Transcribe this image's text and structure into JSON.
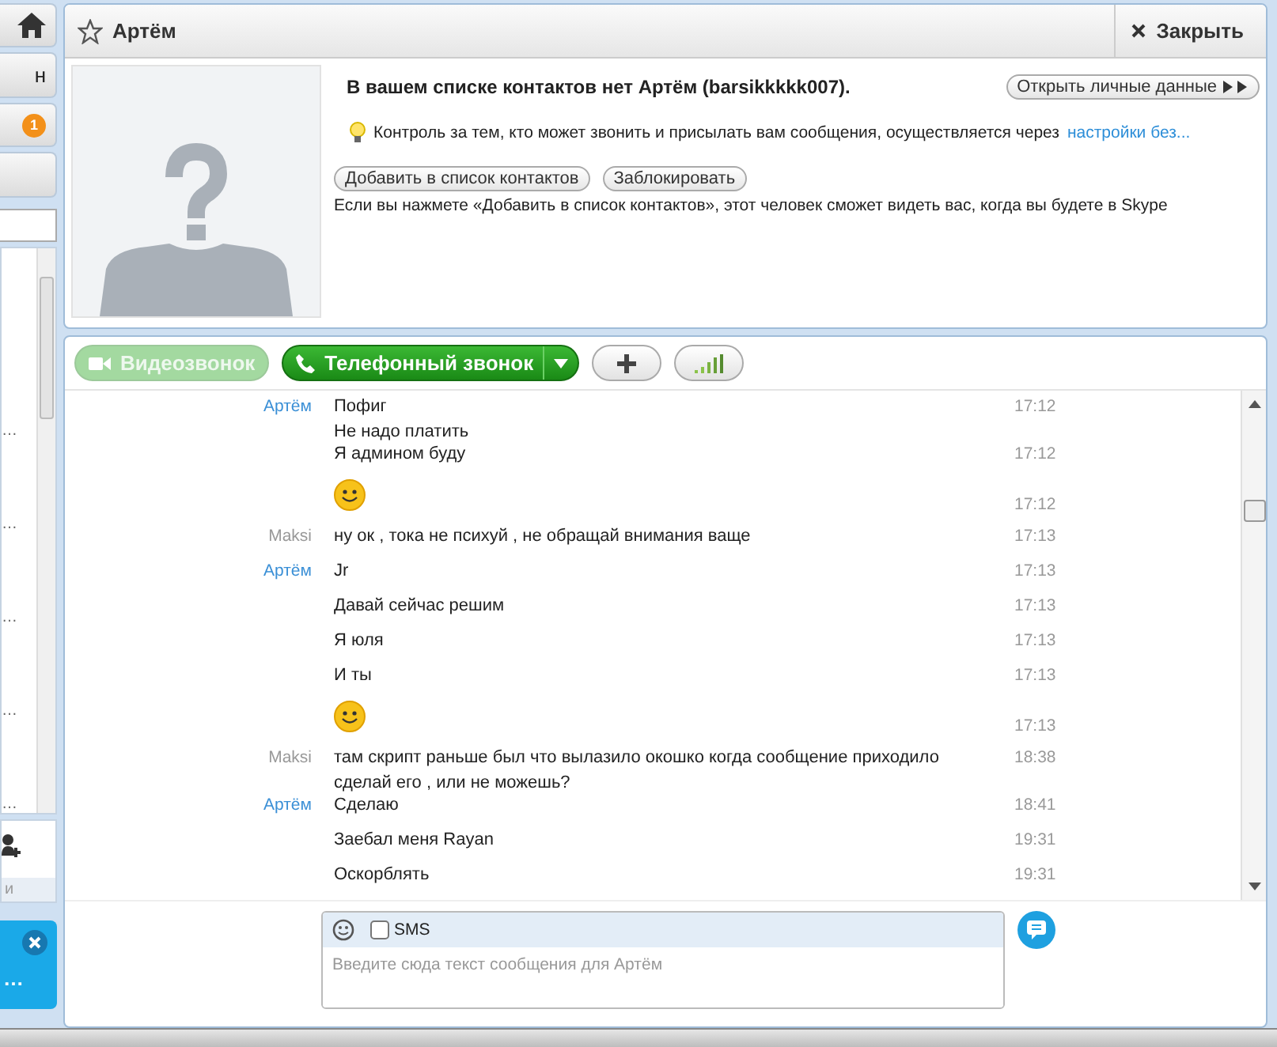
{
  "sidebar": {
    "partial_label": "н",
    "badge": "1",
    "list_items": [
      "…",
      "…",
      "…",
      "…",
      "…"
    ],
    "footer_label": "и",
    "notification_text": "…"
  },
  "header": {
    "contact_name": "Артём",
    "close_button": "Закрыть"
  },
  "profile": {
    "title": "В вашем списке контактов нет Артём (barsikkkkk007).",
    "open_profile_button": "Открыть личные данные",
    "privacy_text": "Контроль за тем, кто может звонить и присылать вам сообщения, осуществляется через",
    "privacy_link": "настройки без...",
    "buttons": [
      "Добавить в список контактов",
      "Заблокировать"
    ],
    "note": "Если вы нажмете «Добавить в список контактов», этот человек сможет видеть вас, когда вы будете в Skype"
  },
  "call_toolbar": {
    "video_call": {
      "label": "Видеозвонок",
      "disabled": true
    },
    "phone_call": {
      "label": "Телефонный звонок",
      "disabled": false
    }
  },
  "messages": [
    {
      "sender": "Артём",
      "self": false,
      "kind": "text",
      "lines": [
        "Пофиг",
        "Не надо платить"
      ],
      "time": "17:12"
    },
    {
      "kind": "text",
      "lines": [
        "Я админом буду"
      ],
      "time": "17:12"
    },
    {
      "kind": "emoticon",
      "time": "17:12"
    },
    {
      "sender": "Maksi",
      "self": true,
      "kind": "text",
      "lines": [
        "ну ок , тока не психуй , не обращай внимания ваще"
      ],
      "time": "17:13"
    },
    {
      "sender": "Артём",
      "self": false,
      "kind": "text",
      "lines": [
        "Jr"
      ],
      "time": "17:13"
    },
    {
      "kind": "text",
      "lines": [
        "Давай сейчас решим"
      ],
      "time": "17:13"
    },
    {
      "kind": "text",
      "lines": [
        "Я юля"
      ],
      "time": "17:13"
    },
    {
      "kind": "text",
      "lines": [
        "И ты"
      ],
      "time": "17:13"
    },
    {
      "kind": "emoticon",
      "time": "17:13"
    },
    {
      "sender": "Maksi",
      "self": true,
      "kind": "text",
      "lines": [
        "там скрипт раньше был что вылазило окошко когда сообщение приходило",
        "сделай его , или не можешь?"
      ],
      "time": "18:38"
    },
    {
      "sender": "Артём",
      "self": false,
      "kind": "text",
      "lines": [
        "Сделаю"
      ],
      "time": "18:41"
    },
    {
      "kind": "text",
      "lines": [
        "Заебал меня Rayan"
      ],
      "time": "19:31"
    },
    {
      "kind": "text",
      "lines": [
        "Оскорблять"
      ],
      "time": "19:31"
    }
  ],
  "composer": {
    "sms_label": "SMS",
    "sms_checked": false,
    "placeholder": "Введите сюда текст сообщения для Артём"
  }
}
